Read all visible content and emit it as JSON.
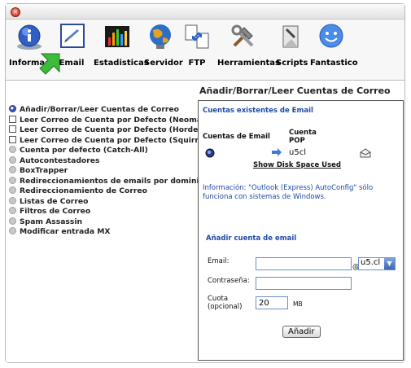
{
  "toolbar": {
    "items": [
      {
        "label": "Informac",
        "icon": "info-icon"
      },
      {
        "label": "Email",
        "icon": "email-icon"
      },
      {
        "label": "Estadisticas",
        "icon": "statistics-icon"
      },
      {
        "label": "Servidor",
        "icon": "server-globe-icon"
      },
      {
        "label": "FTP",
        "icon": "ftp-icon"
      },
      {
        "label": "Herramientas",
        "icon": "tools-icon"
      },
      {
        "label": "Scripts",
        "icon": "scripts-icon"
      },
      {
        "label": "Fantastico",
        "icon": "smiley-icon"
      }
    ]
  },
  "page": {
    "heading": "Añadir/Borrar/Leer Cuentas de Correo"
  },
  "menu": {
    "items": [
      {
        "label": "Añadir/Borrar/Leer Cuentas de Correo",
        "marker": "radio"
      },
      {
        "label": "Leer Correo de Cuenta por Defecto (Neomail)",
        "marker": "box"
      },
      {
        "label": "Leer Correo de Cuenta por Defecto (Horde)",
        "marker": "box"
      },
      {
        "label": "Leer Correo de Cuenta por Defecto (Squirrelmail)",
        "marker": "box"
      },
      {
        "label": "Cuenta por defecto (Catch-All)",
        "marker": "dot"
      },
      {
        "label": "Autocontestadores",
        "marker": "dot"
      },
      {
        "label": "BoxTrapper",
        "marker": "dot"
      },
      {
        "label": "Redireccionamientos de emails por dominio.",
        "marker": "dot"
      },
      {
        "label": "Redireccionamiento de Correo",
        "marker": "dot"
      },
      {
        "label": "Listas de Correo",
        "marker": "dot"
      },
      {
        "label": "Filtros de Correo",
        "marker": "dot"
      },
      {
        "label": "Spam Assassin",
        "marker": "dot"
      },
      {
        "label": "Modificar entrada MX",
        "marker": "dot"
      }
    ]
  },
  "accounts": {
    "title": "Cuentas existentes de Email",
    "col_email": "Cuentas de Email",
    "col_pop": "Cuenta POP",
    "pop_account": "u5cl",
    "disk_link": "Show Disk Space Used"
  },
  "info_text": "Información: \"Outlook (Express) AutoConfig\" sólo funciona con sistemas de Windows.",
  "add_form": {
    "title": "Añadir cuenta de email",
    "email_label": "Email:",
    "email_value": "",
    "at_sign": "@",
    "domain_selected": "u5.cl",
    "password_label": "Contraseña:",
    "password_value": "",
    "quota_label_1": "Cuota",
    "quota_label_2": "(opcional)",
    "quota_value": "20",
    "quota_unit": "MB",
    "submit_label": "Añadir"
  }
}
